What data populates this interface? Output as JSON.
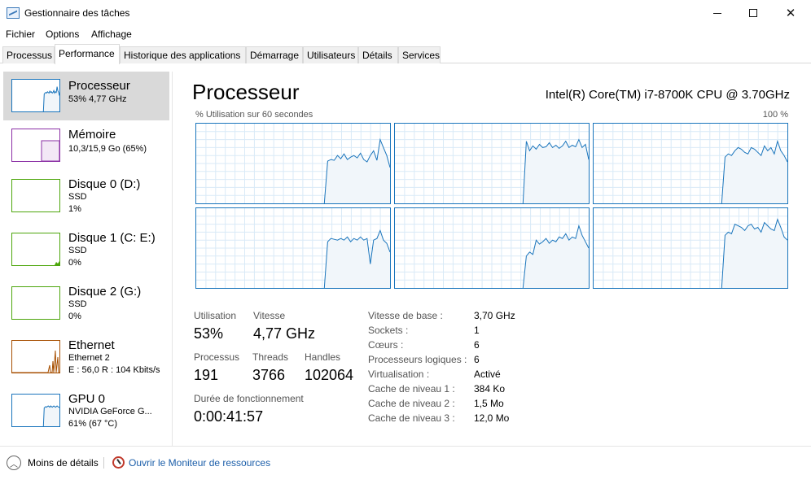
{
  "window": {
    "title": "Gestionnaire des tâches"
  },
  "menu": [
    "Fichier",
    "Options",
    "Affichage"
  ],
  "tabs": [
    "Processus",
    "Performance",
    "Historique des applications",
    "Démarrage",
    "Utilisateurs",
    "Détails",
    "Services"
  ],
  "active_tab": "Performance",
  "sidebar": {
    "items": [
      {
        "title": "Processeur",
        "sub1": "53% 4,77 GHz",
        "sub2": "",
        "sub3": "",
        "color": "#1a75bc",
        "fill": "#f1f6fa",
        "selected": true
      },
      {
        "title": "Mémoire",
        "sub1": "10,3/15,9 Go (65%)",
        "sub2": "",
        "sub3": "",
        "color": "#8b2fa5",
        "fill": "#f3e8f6",
        "selected": false
      },
      {
        "title": "Disque 0 (D:)",
        "sub1": "SSD",
        "sub2": "1%",
        "sub3": "",
        "color": "#4da60c",
        "fill": "#eff7ea",
        "selected": false
      },
      {
        "title": "Disque 1 (C: E:)",
        "sub1": "SSD",
        "sub2": "0%",
        "sub3": "",
        "color": "#4da60c",
        "fill": "#eff7ea",
        "selected": false
      },
      {
        "title": "Disque 2 (G:)",
        "sub1": "SSD",
        "sub2": "0%",
        "sub3": "",
        "color": "#4da60c",
        "fill": "#eff7ea",
        "selected": false
      },
      {
        "title": "Ethernet",
        "sub1": "Ethernet 2",
        "sub2": "E : 56,0 R : 104 Kbits/s",
        "sub3": "",
        "color": "#a74f01",
        "fill": "#fcf3eb",
        "selected": false
      },
      {
        "title": "GPU 0",
        "sub1": "NVIDIA GeForce G...",
        "sub2": "61% (67 °C)",
        "sub3": "",
        "color": "#1a75bc",
        "fill": "#f1f6fa",
        "selected": false
      }
    ]
  },
  "main": {
    "title": "Processeur",
    "cpu_model": "Intel(R) Core(TM) i7-8700K CPU @ 3.70GHz",
    "graph_label": "% Utilisation sur 60 secondes",
    "graph_max": "100 %",
    "stats": {
      "utilisation_label": "Utilisation",
      "utilisation": "53%",
      "vitesse_label": "Vitesse",
      "vitesse": "4,77 GHz",
      "processus_label": "Processus",
      "processus": "191",
      "threads_label": "Threads",
      "threads": "3766",
      "handles_label": "Handles",
      "handles": "102064",
      "uptime_label": "Durée de fonctionnement",
      "uptime": "0:00:41:57"
    },
    "specs": [
      {
        "label": "Vitesse de base :",
        "value": "3,70 GHz"
      },
      {
        "label": "Sockets :",
        "value": "1"
      },
      {
        "label": "Cœurs :",
        "value": "6"
      },
      {
        "label": "Processeurs logiques :",
        "value": "6"
      },
      {
        "label": "Virtualisation :",
        "value": "Activé"
      },
      {
        "label": "Cache de niveau 1 :",
        "value": "384 Ko"
      },
      {
        "label": "Cache de niveau 2 :",
        "value": "1,5 Mo"
      },
      {
        "label": "Cache de niveau 3 :",
        "value": "12,0 Mo"
      }
    ]
  },
  "core_usage": [
    [
      0,
      0,
      0,
      0,
      0,
      0,
      0,
      0,
      0,
      0,
      0,
      0,
      0,
      0,
      0,
      0,
      0,
      0,
      0,
      0,
      0,
      0,
      0,
      0,
      0,
      0,
      0,
      0,
      0,
      0,
      0,
      0,
      0,
      0,
      0,
      0,
      0,
      0,
      0,
      0,
      53,
      55,
      54,
      60,
      56,
      62,
      55,
      58,
      60,
      57,
      63,
      55,
      52,
      60,
      66,
      54,
      80,
      70,
      60,
      45
    ],
    [
      0,
      0,
      0,
      0,
      0,
      0,
      0,
      0,
      0,
      0,
      0,
      0,
      0,
      0,
      0,
      0,
      0,
      0,
      0,
      0,
      0,
      0,
      0,
      0,
      0,
      0,
      0,
      0,
      0,
      0,
      0,
      0,
      0,
      0,
      0,
      0,
      0,
      0,
      0,
      0,
      78,
      66,
      72,
      68,
      74,
      70,
      71,
      76,
      70,
      73,
      69,
      72,
      78,
      70,
      73,
      71,
      80,
      70,
      74,
      55
    ],
    [
      0,
      0,
      0,
      0,
      0,
      0,
      0,
      0,
      0,
      0,
      0,
      0,
      0,
      0,
      0,
      0,
      0,
      0,
      0,
      0,
      0,
      0,
      0,
      0,
      0,
      0,
      0,
      0,
      0,
      0,
      0,
      0,
      0,
      0,
      0,
      0,
      0,
      0,
      0,
      0,
      58,
      62,
      60,
      66,
      70,
      68,
      64,
      62,
      70,
      68,
      64,
      60,
      72,
      66,
      70,
      62,
      78,
      66,
      60,
      52
    ],
    [
      0,
      0,
      0,
      0,
      0,
      0,
      0,
      0,
      0,
      0,
      0,
      0,
      0,
      0,
      0,
      0,
      0,
      0,
      0,
      0,
      0,
      0,
      0,
      0,
      0,
      0,
      0,
      0,
      0,
      0,
      0,
      0,
      0,
      0,
      0,
      0,
      0,
      0,
      0,
      0,
      58,
      62,
      61,
      60,
      62,
      60,
      64,
      58,
      62,
      60,
      64,
      60,
      62,
      30,
      60,
      62,
      72,
      60,
      56,
      45
    ],
    [
      0,
      0,
      0,
      0,
      0,
      0,
      0,
      0,
      0,
      0,
      0,
      0,
      0,
      0,
      0,
      0,
      0,
      0,
      0,
      0,
      0,
      0,
      0,
      0,
      0,
      0,
      0,
      0,
      0,
      0,
      0,
      0,
      0,
      0,
      0,
      0,
      0,
      0,
      0,
      0,
      40,
      45,
      42,
      60,
      55,
      58,
      62,
      56,
      60,
      58,
      64,
      62,
      68,
      60,
      64,
      62,
      78,
      66,
      58,
      50
    ],
    [
      0,
      0,
      0,
      0,
      0,
      0,
      0,
      0,
      0,
      0,
      0,
      0,
      0,
      0,
      0,
      0,
      0,
      0,
      0,
      0,
      0,
      0,
      0,
      0,
      0,
      0,
      0,
      0,
      0,
      0,
      0,
      0,
      0,
      0,
      0,
      0,
      0,
      0,
      0,
      0,
      66,
      70,
      68,
      80,
      78,
      76,
      72,
      78,
      80,
      74,
      76,
      70,
      82,
      78,
      74,
      72,
      86,
      76,
      64,
      60
    ]
  ],
  "side_usage": {
    "cpu": [
      0,
      0,
      0,
      0,
      0,
      0,
      0,
      0,
      0,
      0,
      0,
      0,
      0,
      0,
      0,
      0,
      0,
      0,
      0,
      0,
      0,
      0,
      0,
      0,
      0,
      0,
      0,
      0,
      0,
      0,
      0,
      0,
      0,
      0,
      0,
      0,
      0,
      0,
      0,
      0,
      55,
      58,
      60,
      58,
      62,
      60,
      58,
      64,
      60,
      62,
      58,
      60,
      66,
      58,
      62,
      60,
      78,
      66,
      60,
      50
    ],
    "mem": [
      0,
      0,
      0,
      0,
      0,
      0,
      0,
      0,
      0,
      0,
      0,
      0,
      0,
      0,
      0,
      0,
      0,
      0,
      0,
      0,
      0,
      0,
      0,
      0,
      0,
      0,
      0,
      0,
      0,
      0,
      0,
      0,
      0,
      0,
      0,
      0,
      0,
      0,
      0,
      0,
      0,
      0,
      0,
      0,
      0,
      0,
      0,
      0,
      0,
      0,
      0,
      0,
      0,
      0,
      0,
      0,
      0,
      0,
      0,
      0
    ],
    "gpu": [
      0,
      0,
      0,
      0,
      0,
      0,
      0,
      0,
      0,
      0,
      0,
      0,
      0,
      0,
      0,
      0,
      0,
      0,
      0,
      0,
      0,
      0,
      0,
      0,
      0,
      0,
      0,
      0,
      0,
      0,
      0,
      0,
      0,
      0,
      0,
      0,
      0,
      0,
      0,
      0,
      58,
      60,
      62,
      60,
      62,
      64,
      62,
      60,
      64,
      62,
      60,
      62,
      64,
      62,
      60,
      62,
      64,
      62,
      60,
      60
    ]
  },
  "footer": {
    "less_details": "Moins de détails",
    "resmon": "Ouvrir le Moniteur de ressources"
  }
}
